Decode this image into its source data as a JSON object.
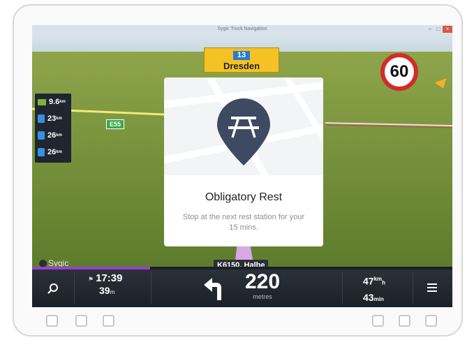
{
  "window": {
    "title": "Sygic Truck Navigation"
  },
  "exit_sign": {
    "number": "13",
    "city": "Dresden"
  },
  "speed_limit": "60",
  "poi_list": [
    {
      "icon": "truck-icon",
      "distance": "9.6",
      "unit": "km"
    },
    {
      "icon": "fuel-icon",
      "distance": "23",
      "unit": "km"
    },
    {
      "icon": "fuel-icon",
      "distance": "26",
      "unit": "km"
    },
    {
      "icon": "fuel-icon",
      "distance": "26",
      "unit": "km"
    }
  ],
  "road_sign": "E55",
  "dialog": {
    "icon": "picnic-table-icon",
    "title": "Obligatory Rest",
    "text": "Stop at the next rest station for your 15 mins."
  },
  "street_name": "K6150, Halbe",
  "brand": "Sygic",
  "route_progress": 0.28,
  "bottom_bar": {
    "eta_time": "17:39",
    "eta_distance": "39",
    "eta_distance_unit": "m",
    "turn_icon": "turn-left-arrow-icon",
    "next_turn_distance": "220",
    "next_turn_unit": "metres",
    "remaining_km": "47",
    "remaining_km_unit": "km",
    "remaining_h_unit": "h",
    "remaining_min": "43",
    "remaining_min_unit": "min"
  },
  "colors": {
    "accent": "#9b3fd0",
    "speed_limit_ring": "#d42a2a",
    "exit_sign": "#f4c224",
    "pin": "#3d4a62"
  }
}
